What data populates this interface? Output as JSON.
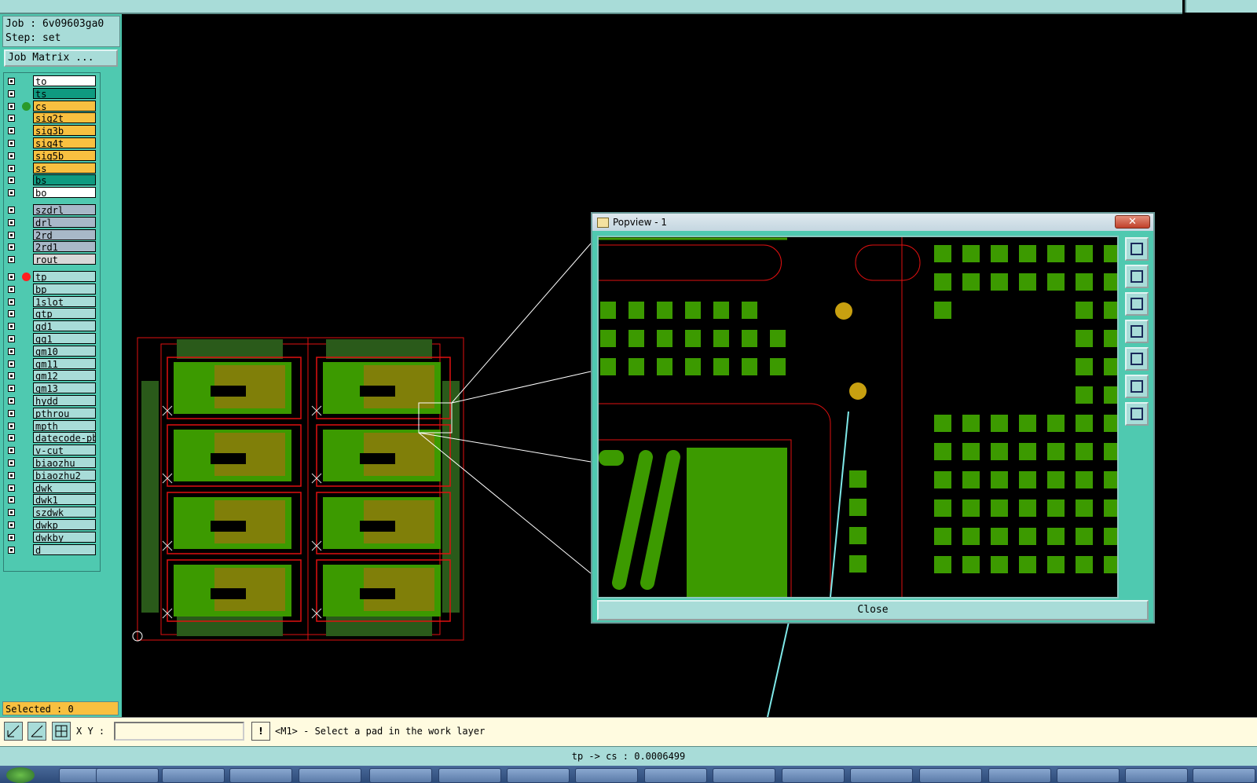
{
  "job": {
    "job_line": "Job : 6v09603ga0",
    "step_line": "Step: set",
    "matrix_button": "Job Matrix ..."
  },
  "layers": [
    {
      "name": "to",
      "color": "#ffffff",
      "dot": ""
    },
    {
      "name": "ts",
      "color": "#0f9a80",
      "dot": ""
    },
    {
      "name": "cs",
      "color": "#f8c040",
      "dot": "#2a9a2a"
    },
    {
      "name": "sig2t",
      "color": "#f8c040",
      "dot": ""
    },
    {
      "name": "sig3b",
      "color": "#f8c040",
      "dot": ""
    },
    {
      "name": "sig4t",
      "color": "#f8c040",
      "dot": ""
    },
    {
      "name": "sig5b",
      "color": "#f8c040",
      "dot": ""
    },
    {
      "name": "ss",
      "color": "#f8c040",
      "dot": ""
    },
    {
      "name": "bs",
      "color": "#0f9a80",
      "dot": ""
    },
    {
      "name": "bo",
      "color": "#ffffff",
      "dot": ""
    },
    {
      "name": "szdrl",
      "color": "#a8b8c8",
      "dot": ""
    },
    {
      "name": "drl",
      "color": "#a8b8c8",
      "dot": ""
    },
    {
      "name": "2rd",
      "color": "#a8b8c8",
      "dot": ""
    },
    {
      "name": "2rd1",
      "color": "#a8b8c8",
      "dot": ""
    },
    {
      "name": "rout",
      "color": "#d8d8d8",
      "dot": ""
    },
    {
      "name": "tp",
      "color": "#a8dcd8",
      "dot": "#ff2020"
    },
    {
      "name": "bp",
      "color": "#a8dcd8",
      "dot": ""
    },
    {
      "name": "1slot",
      "color": "#a8dcd8",
      "dot": ""
    },
    {
      "name": "gtp",
      "color": "#a8dcd8",
      "dot": ""
    },
    {
      "name": "gd1",
      "color": "#a8dcd8",
      "dot": ""
    },
    {
      "name": "gg1",
      "color": "#a8dcd8",
      "dot": ""
    },
    {
      "name": "gm10",
      "color": "#a8dcd8",
      "dot": ""
    },
    {
      "name": "gm11",
      "color": "#a8dcd8",
      "dot": ""
    },
    {
      "name": "gm12",
      "color": "#a8dcd8",
      "dot": ""
    },
    {
      "name": "gm13",
      "color": "#a8dcd8",
      "dot": ""
    },
    {
      "name": "hydd",
      "color": "#a8dcd8",
      "dot": ""
    },
    {
      "name": "pthrou",
      "color": "#a8dcd8",
      "dot": ""
    },
    {
      "name": "mpth",
      "color": "#a8dcd8",
      "dot": ""
    },
    {
      "name": "datecode-pbe",
      "color": "#a8dcd8",
      "dot": ""
    },
    {
      "name": "v-cut",
      "color": "#a8dcd8",
      "dot": ""
    },
    {
      "name": "biaozhu",
      "color": "#a8dcd8",
      "dot": ""
    },
    {
      "name": "biaozhu2",
      "color": "#a8dcd8",
      "dot": ""
    },
    {
      "name": "dwk",
      "color": "#a8dcd8",
      "dot": ""
    },
    {
      "name": "dwk1",
      "color": "#a8dcd8",
      "dot": ""
    },
    {
      "name": "szdwk",
      "color": "#a8dcd8",
      "dot": ""
    },
    {
      "name": "dwkp",
      "color": "#a8dcd8",
      "dot": ""
    },
    {
      "name": "dwkby",
      "color": "#a8dcd8",
      "dot": ""
    },
    {
      "name": "d",
      "color": "#a8dcd8",
      "dot": ""
    }
  ],
  "selected": "Selected : 0",
  "cmd": {
    "xy_label": "X Y :",
    "xy_value": "",
    "prompt": "<M1> - Select a pad in the work layer"
  },
  "status": "tp -> cs : 0.0006499",
  "popview": {
    "title": "Popview - 1",
    "close": "Close"
  },
  "colors": {
    "canvas": "#000000",
    "panel": "#4fc9b0",
    "copper": "#3c9a00",
    "outline": "#e01010",
    "pad_gold": "#c8a010"
  }
}
